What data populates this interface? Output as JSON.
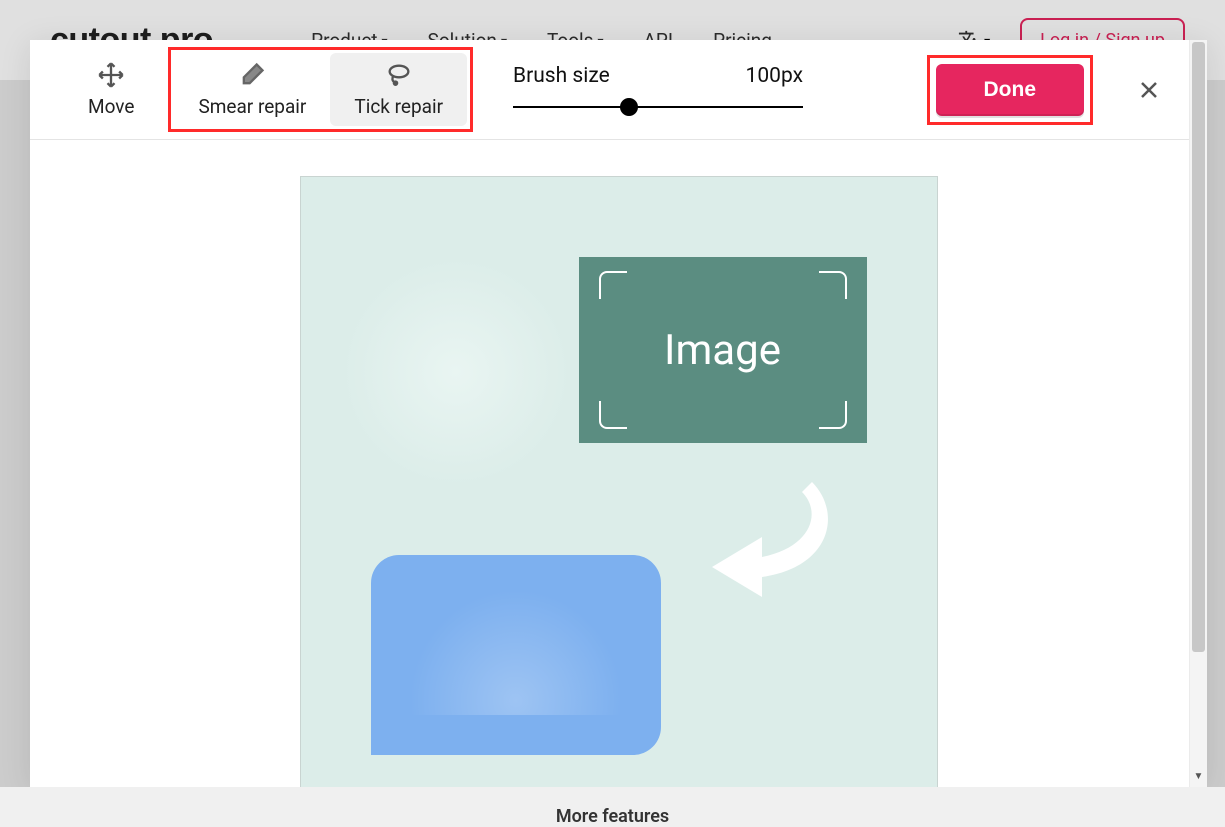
{
  "header": {
    "logo": "cutout.pro",
    "nav": {
      "product": "Product",
      "solution": "Solution",
      "tools": "Tools",
      "api": "API",
      "pricing": "Pricing"
    },
    "login": "Log in / Sign up"
  },
  "toolbar": {
    "move_label": "Move",
    "smear_label": "Smear repair",
    "tick_label": "Tick repair",
    "brush_label": "Brush size",
    "brush_value": "100px",
    "brush_slider_percent": 40,
    "done_label": "Done"
  },
  "canvas": {
    "image_placeholder_text": "Image"
  },
  "footer": {
    "more_features": "More features"
  }
}
